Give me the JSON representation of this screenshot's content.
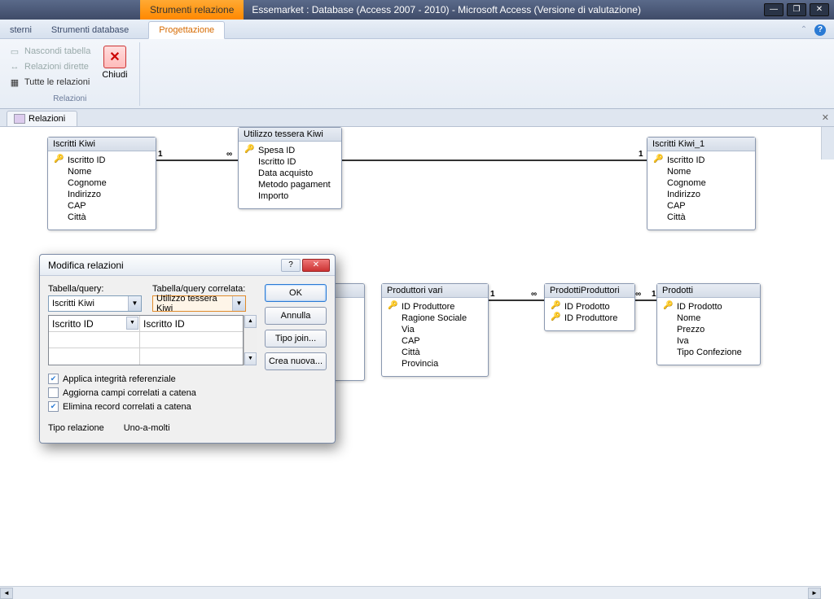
{
  "title_bar": {
    "context_tool": "Strumenti relazione",
    "app_title": "Essemarket : Database (Access 2007 - 2010)  -  Microsoft Access (Versione di valutazione)"
  },
  "ribbon_tabs": {
    "t1": "sterni",
    "t2": "Strumenti database",
    "t3": "Progettazione"
  },
  "ribbon": {
    "hide_table": "Nascondi tabella",
    "direct_rel": "Relazioni dirette",
    "all_rel": "Tutte le relazioni",
    "close": "Chiudi",
    "group1": "Relazioni"
  },
  "doc_tab": "Relazioni",
  "tables": {
    "iscritti": {
      "title": "Iscritti Kiwi",
      "f1": "Iscritto ID",
      "f2": "Nome",
      "f3": "Cognome",
      "f4": "Indirizzo",
      "f5": "CAP",
      "f6": "Città"
    },
    "utilizzo": {
      "title": "Utilizzo tessera Kiwi",
      "f1": "Spesa ID",
      "f2": "Iscritto ID",
      "f3": "Data acquisto",
      "f4": "Metodo pagament",
      "f5": "Importo"
    },
    "iscritti1": {
      "title": "Iscritti Kiwi_1",
      "f1": "Iscritto ID",
      "f2": "Nome",
      "f3": "Cognome",
      "f4": "Indirizzo",
      "f5": "CAP",
      "f6": "Città"
    },
    "produttori": {
      "title": "Produttori vari",
      "f1": "ID Produttore",
      "f2": "Ragione Sociale",
      "f3": "Via",
      "f4": "CAP",
      "f5": "Città",
      "f6": "Provincia"
    },
    "prodprod": {
      "title": "ProdottiProduttori",
      "f1": "ID Prodotto",
      "f2": "ID Produttore"
    },
    "prodotti": {
      "title": "Prodotti",
      "f1": "ID Prodotto",
      "f2": "Nome",
      "f3": "Prezzo",
      "f4": "Iva",
      "f5": "Tipo Confezione"
    }
  },
  "rel_labels": {
    "one": "1",
    "inf": "∞"
  },
  "dialog": {
    "title": "Modifica relazioni",
    "lbl_table": "Tabella/query:",
    "lbl_related": "Tabella/query correlata:",
    "combo1": "Iscritti Kiwi",
    "combo2": "Utilizzo tessera Kiwi",
    "cell_l": "Iscritto ID",
    "cell_r": "Iscritto ID",
    "btn_ok": "OK",
    "btn_cancel": "Annulla",
    "btn_join": "Tipo join...",
    "btn_new": "Crea nuova...",
    "chk1": "Applica integrità referenziale",
    "chk2": "Aggiorna campi correlati a catena",
    "chk3": "Elimina record correlati a catena",
    "type_lbl": "Tipo relazione",
    "type_val": "Uno-a-molti"
  }
}
